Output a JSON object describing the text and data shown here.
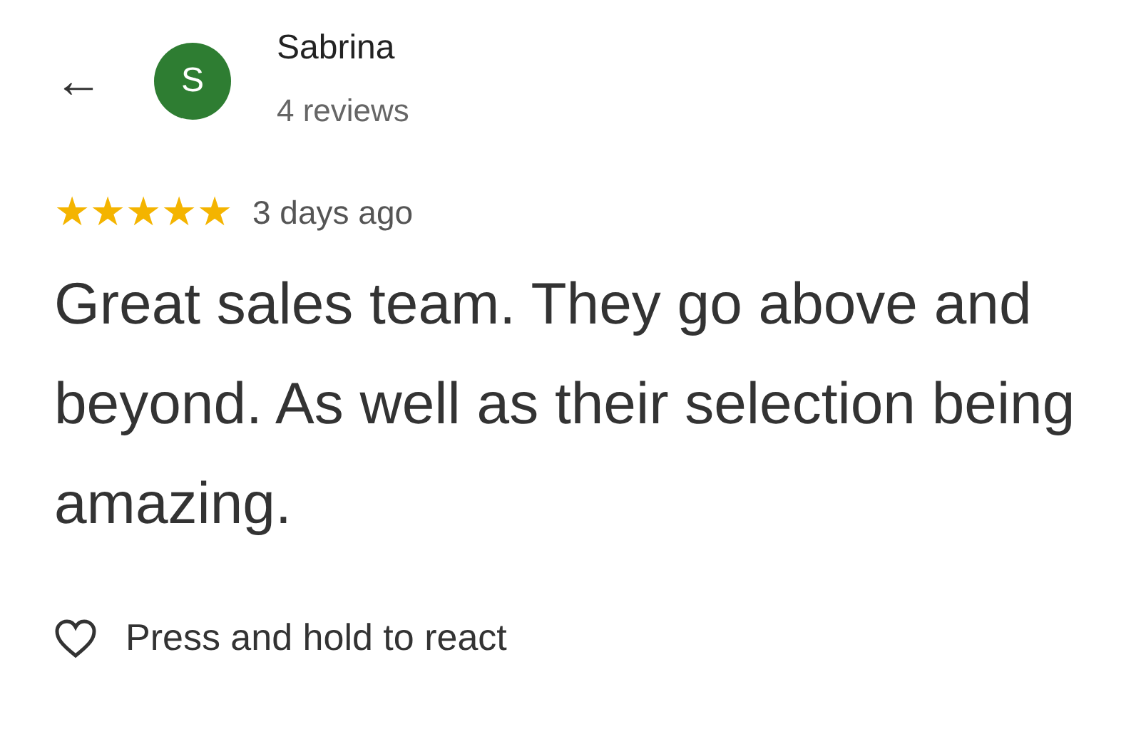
{
  "header": {
    "back": "←",
    "avatar_letter": "S",
    "name": "Sabrina",
    "reviews": "4 reviews"
  },
  "rating": {
    "stars": 5,
    "time": "3 days ago"
  },
  "review_text": "Great sales team. They go above and beyond. As well as their selection being amazing.",
  "react": {
    "label": "Press and hold to react"
  }
}
